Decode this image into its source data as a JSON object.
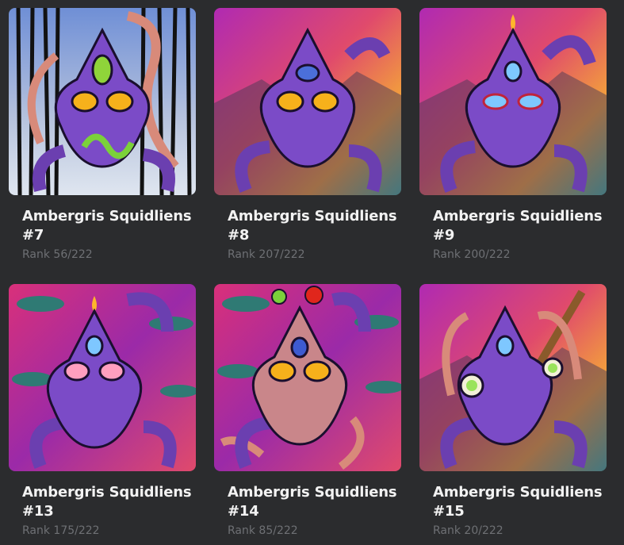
{
  "cards": [
    {
      "name": "Ambergris Squidliens",
      "number": "#7",
      "rank": "Rank 56/222",
      "background": "forest",
      "eye_color": "#f6b11b",
      "third_eye": "#8fd43a"
    },
    {
      "name": "Ambergris Squidliens",
      "number": "#8",
      "rank": "Rank 207/222",
      "background": "sunset",
      "eye_color": "#f6b11b",
      "third_eye": "#4b6fd9"
    },
    {
      "name": "Ambergris Squidliens",
      "number": "#9",
      "rank": "Rank 200/222",
      "background": "sunset",
      "eye_color": "#7ec7ff",
      "third_eye": "#7ec7ff"
    },
    {
      "name": "Ambergris Squidliens",
      "number": "#13",
      "rank": "Rank 175/222",
      "background": "whales",
      "eye_color": "#ff9fbf",
      "third_eye": "#7ec7ff"
    },
    {
      "name": "Ambergris Squidliens",
      "number": "#14",
      "rank": "Rank 85/222",
      "background": "whales",
      "eye_color": "#f6b11b",
      "third_eye": "#4b6fd9"
    },
    {
      "name": "Ambergris Squidliens",
      "number": "#15",
      "rank": "Rank 20/222",
      "background": "sunset",
      "eye_color": "#9ae35b",
      "third_eye": "#7ec7ff"
    }
  ]
}
